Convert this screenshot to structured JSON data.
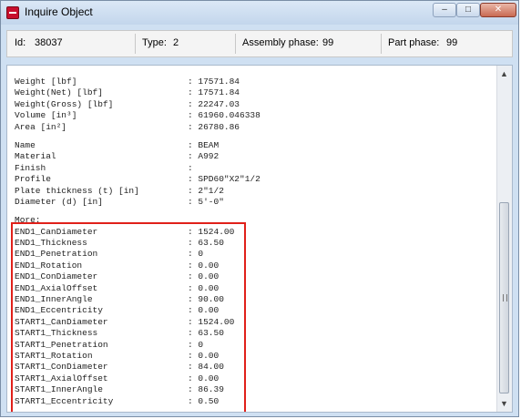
{
  "window": {
    "title": "Inquire Object"
  },
  "info": {
    "id_label": "Id:",
    "id_value": "38037",
    "type_label": "Type:",
    "type_value": "2",
    "assembly_label": "Assembly phase:",
    "assembly_value": "99",
    "part_label": "Part phase:",
    "part_value": "99"
  },
  "rows_group1": [
    {
      "label": "Weight [lbf]",
      "value": ": 17571.84"
    },
    {
      "label": "Weight(Net) [lbf]",
      "value": ": 17571.84"
    },
    {
      "label": "Weight(Gross) [lbf]",
      "value": ": 22247.03"
    },
    {
      "label": "Volume [in³]",
      "value": ": 61960.046338"
    },
    {
      "label": "Area [in²]",
      "value": ": 26780.86"
    }
  ],
  "rows_group2": [
    {
      "label": "Name",
      "value": ": BEAM"
    },
    {
      "label": "Material",
      "value": ": A992"
    },
    {
      "label": "Finish",
      "value": ":"
    },
    {
      "label": "Profile",
      "value": ": SPD60\"X2\"1/2"
    },
    {
      "label": "Plate thickness (t) [in]",
      "value": ": 2\"1/2"
    },
    {
      "label": "Diameter (d) [in]",
      "value": ": 5'-0\""
    }
  ],
  "rows_group3": [
    {
      "label": "More:",
      "value": ""
    },
    {
      "label": "END1_CanDiameter",
      "value": ": 1524.00"
    },
    {
      "label": "END1_Thickness",
      "value": ": 63.50"
    },
    {
      "label": "END1_Penetration",
      "value": ": 0"
    },
    {
      "label": "END1_Rotation",
      "value": ": 0.00"
    },
    {
      "label": "END1_ConDiameter",
      "value": ": 0.00"
    },
    {
      "label": "END1_AxialOffset",
      "value": ": 0.00"
    },
    {
      "label": "END1_InnerAngle",
      "value": ": 90.00"
    },
    {
      "label": "END1_Eccentricity",
      "value": ": 0.00"
    },
    {
      "label": "START1_CanDiameter",
      "value": ": 1524.00"
    },
    {
      "label": "START1_Thickness",
      "value": ": 63.50"
    },
    {
      "label": "START1_Penetration",
      "value": ": 0"
    },
    {
      "label": "START1_Rotation",
      "value": ": 0.00"
    },
    {
      "label": "START1_ConDiameter",
      "value": ": 84.00"
    },
    {
      "label": "START1_AxialOffset",
      "value": ": 0.00"
    },
    {
      "label": "START1_InnerAngle",
      "value": ": 86.39"
    },
    {
      "label": "START1_Eccentricity",
      "value": ": 0.50"
    }
  ],
  "window_buttons": {
    "min": "–",
    "max": "□",
    "close": "✕"
  },
  "scrollbar": {
    "up": "▲",
    "down": "▼"
  },
  "colors": {
    "highlight": "#e0201a"
  }
}
